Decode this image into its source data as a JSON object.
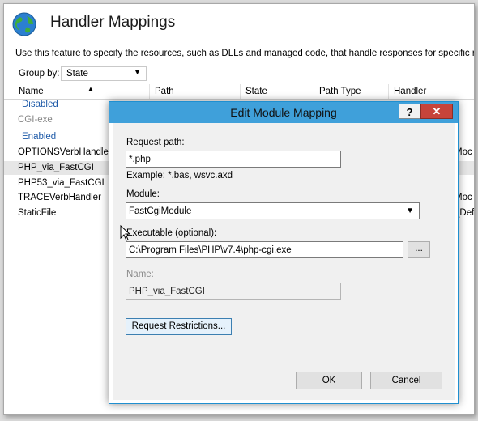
{
  "page": {
    "title": "Handler Mappings",
    "description": "Use this feature to specify the resources, such as DLLs and managed code, that handle responses for specific request",
    "group_by_label": "Group by:",
    "group_by_value": "State"
  },
  "columns": [
    "Name",
    "Path",
    "State",
    "Path Type",
    "Handler"
  ],
  "groups": {
    "disabled": "Disabled",
    "enabled": "Enabled"
  },
  "rows": [
    {
      "name": "CGI-exe",
      "handler": ""
    },
    {
      "name": "OPTIONSVerbHandler",
      "handler": "Moc"
    },
    {
      "name": "PHP_via_FastCGI",
      "handler": ""
    },
    {
      "name": "PHP53_via_FastCGI",
      "handler": ""
    },
    {
      "name": "TRACEVerbHandler",
      "handler": "Moc"
    },
    {
      "name": "StaticFile",
      "handler": "_Def"
    }
  ],
  "dialog": {
    "title": "Edit Module Mapping",
    "help_label": "?",
    "close_label": "✕",
    "request_path_label": "Request path:",
    "request_path_value": "*.php",
    "request_path_example": "Example: *.bas, wsvc.axd",
    "module_label": "Module:",
    "module_value": "FastCgiModule",
    "executable_label": "Executable (optional):",
    "executable_value": "C:\\Program Files\\PHP\\v7.4\\php-cgi.exe",
    "browse_label": "...",
    "name_label": "Name:",
    "name_value": "PHP_via_FastCGI",
    "request_restrictions_label": "Request Restrictions...",
    "ok_label": "OK",
    "cancel_label": "Cancel"
  },
  "icons": {
    "globe": "globe-icon",
    "sort": "sort-up-icon",
    "dropdown": "chevron-down-icon",
    "cursor": "mouse-pointer-icon"
  },
  "colors": {
    "accent": "#3fa0da",
    "group_link": "#1e5aa8",
    "close": "#c7443a"
  }
}
